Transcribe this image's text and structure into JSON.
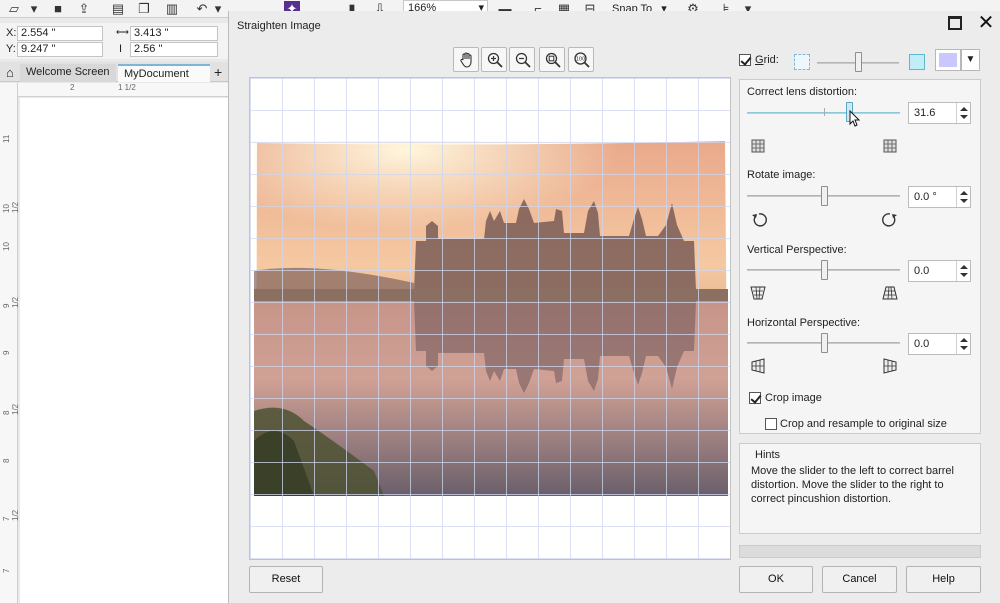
{
  "app": {
    "zoom_level": "166%",
    "snap_label": "Snap To",
    "position": {
      "x_label": "X:",
      "x_value": "2.554 \"",
      "y_label": "Y:",
      "y_value": "9.247 \""
    },
    "size": {
      "w_value": "3.413 \"",
      "h_value": "2.56 \""
    },
    "tabs": [
      {
        "label": "Welcome Screen"
      },
      {
        "label": "MyDocument"
      }
    ],
    "ruler_h": [
      "2",
      "1 1/2"
    ],
    "ruler_v": [
      "11",
      "10 1/2",
      "10",
      "9 1/2",
      "9",
      "8 1/2",
      "8",
      "7 1/2",
      "7"
    ]
  },
  "dialog": {
    "title": "Straighten Image",
    "grid": {
      "label": "Grid:",
      "checked": true,
      "grid_color": "#c8c8ff"
    },
    "lens": {
      "label": "Correct lens distortion:",
      "value": "31.6"
    },
    "rotate": {
      "label": "Rotate image:",
      "value": "0.0 °"
    },
    "vertical": {
      "label": "Vertical Perspective:",
      "value": "0.0"
    },
    "horizontal": {
      "label": "Horizontal Perspective:",
      "value": "0.0"
    },
    "crop": {
      "label": "Crop image",
      "checked": true
    },
    "resample": {
      "label": "Crop and resample to original size",
      "checked": false
    },
    "hints": {
      "title": "Hints",
      "text": "Move the slider to the left to correct barrel distortion. Move the slider to the right to correct pincushion distortion."
    },
    "buttons": {
      "reset": "Reset",
      "ok": "OK",
      "cancel": "Cancel",
      "help": "Help"
    },
    "zoom_tools": [
      "pan-icon",
      "zoom-in-icon",
      "zoom-out-icon",
      "zoom-fit-icon",
      "zoom-100-icon"
    ]
  }
}
